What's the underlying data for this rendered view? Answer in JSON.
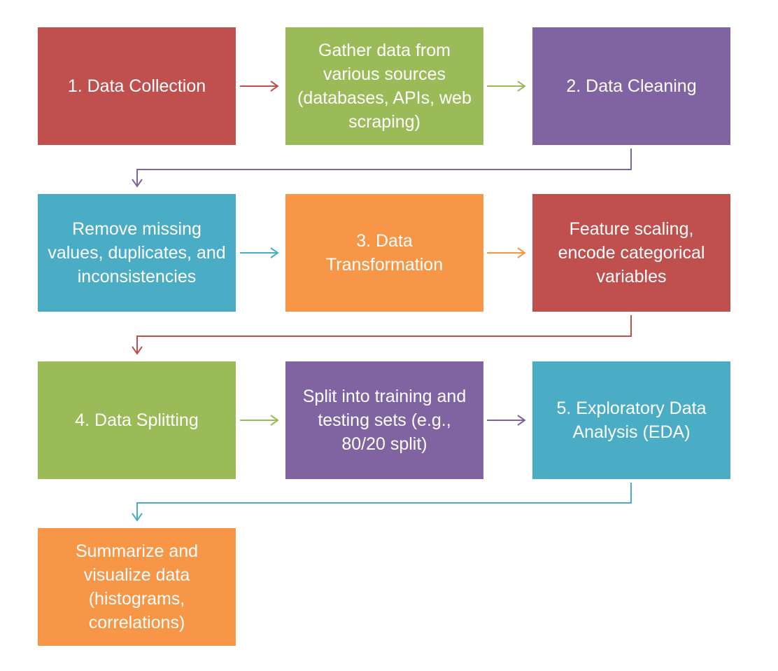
{
  "colors": {
    "red": "#c0504d",
    "green": "#9bbb59",
    "purple": "#8064a2",
    "teal": "#4bacc6",
    "orange": "#f79646"
  },
  "nodes": [
    {
      "id": "n1",
      "label": "1. Data Collection",
      "color": "red"
    },
    {
      "id": "n2",
      "label": "Gather data from various sources (databases, APIs, web scraping)",
      "color": "green"
    },
    {
      "id": "n3",
      "label": "2. Data Cleaning",
      "color": "purple"
    },
    {
      "id": "n4",
      "label": "Remove missing values, duplicates, and inconsistencies",
      "color": "teal"
    },
    {
      "id": "n5",
      "label": "3. Data Transformation",
      "color": "orange"
    },
    {
      "id": "n6",
      "label": "Feature scaling, encode categorical variables",
      "color": "red"
    },
    {
      "id": "n7",
      "label": "4. Data Splitting",
      "color": "green"
    },
    {
      "id": "n8",
      "label": "Split into training and testing sets (e.g., 80/20 split)",
      "color": "purple"
    },
    {
      "id": "n9",
      "label": "5. Exploratory Data Analysis (EDA)",
      "color": "teal"
    },
    {
      "id": "n10",
      "label": "Summarize and visualize data (histograms, correlations)",
      "color": "orange"
    }
  ],
  "edges": [
    {
      "from": "n1",
      "to": "n2"
    },
    {
      "from": "n2",
      "to": "n3"
    },
    {
      "from": "n3",
      "to": "n4"
    },
    {
      "from": "n4",
      "to": "n5"
    },
    {
      "from": "n5",
      "to": "n6"
    },
    {
      "from": "n6",
      "to": "n7"
    },
    {
      "from": "n7",
      "to": "n8"
    },
    {
      "from": "n8",
      "to": "n9"
    },
    {
      "from": "n9",
      "to": "n10"
    }
  ]
}
